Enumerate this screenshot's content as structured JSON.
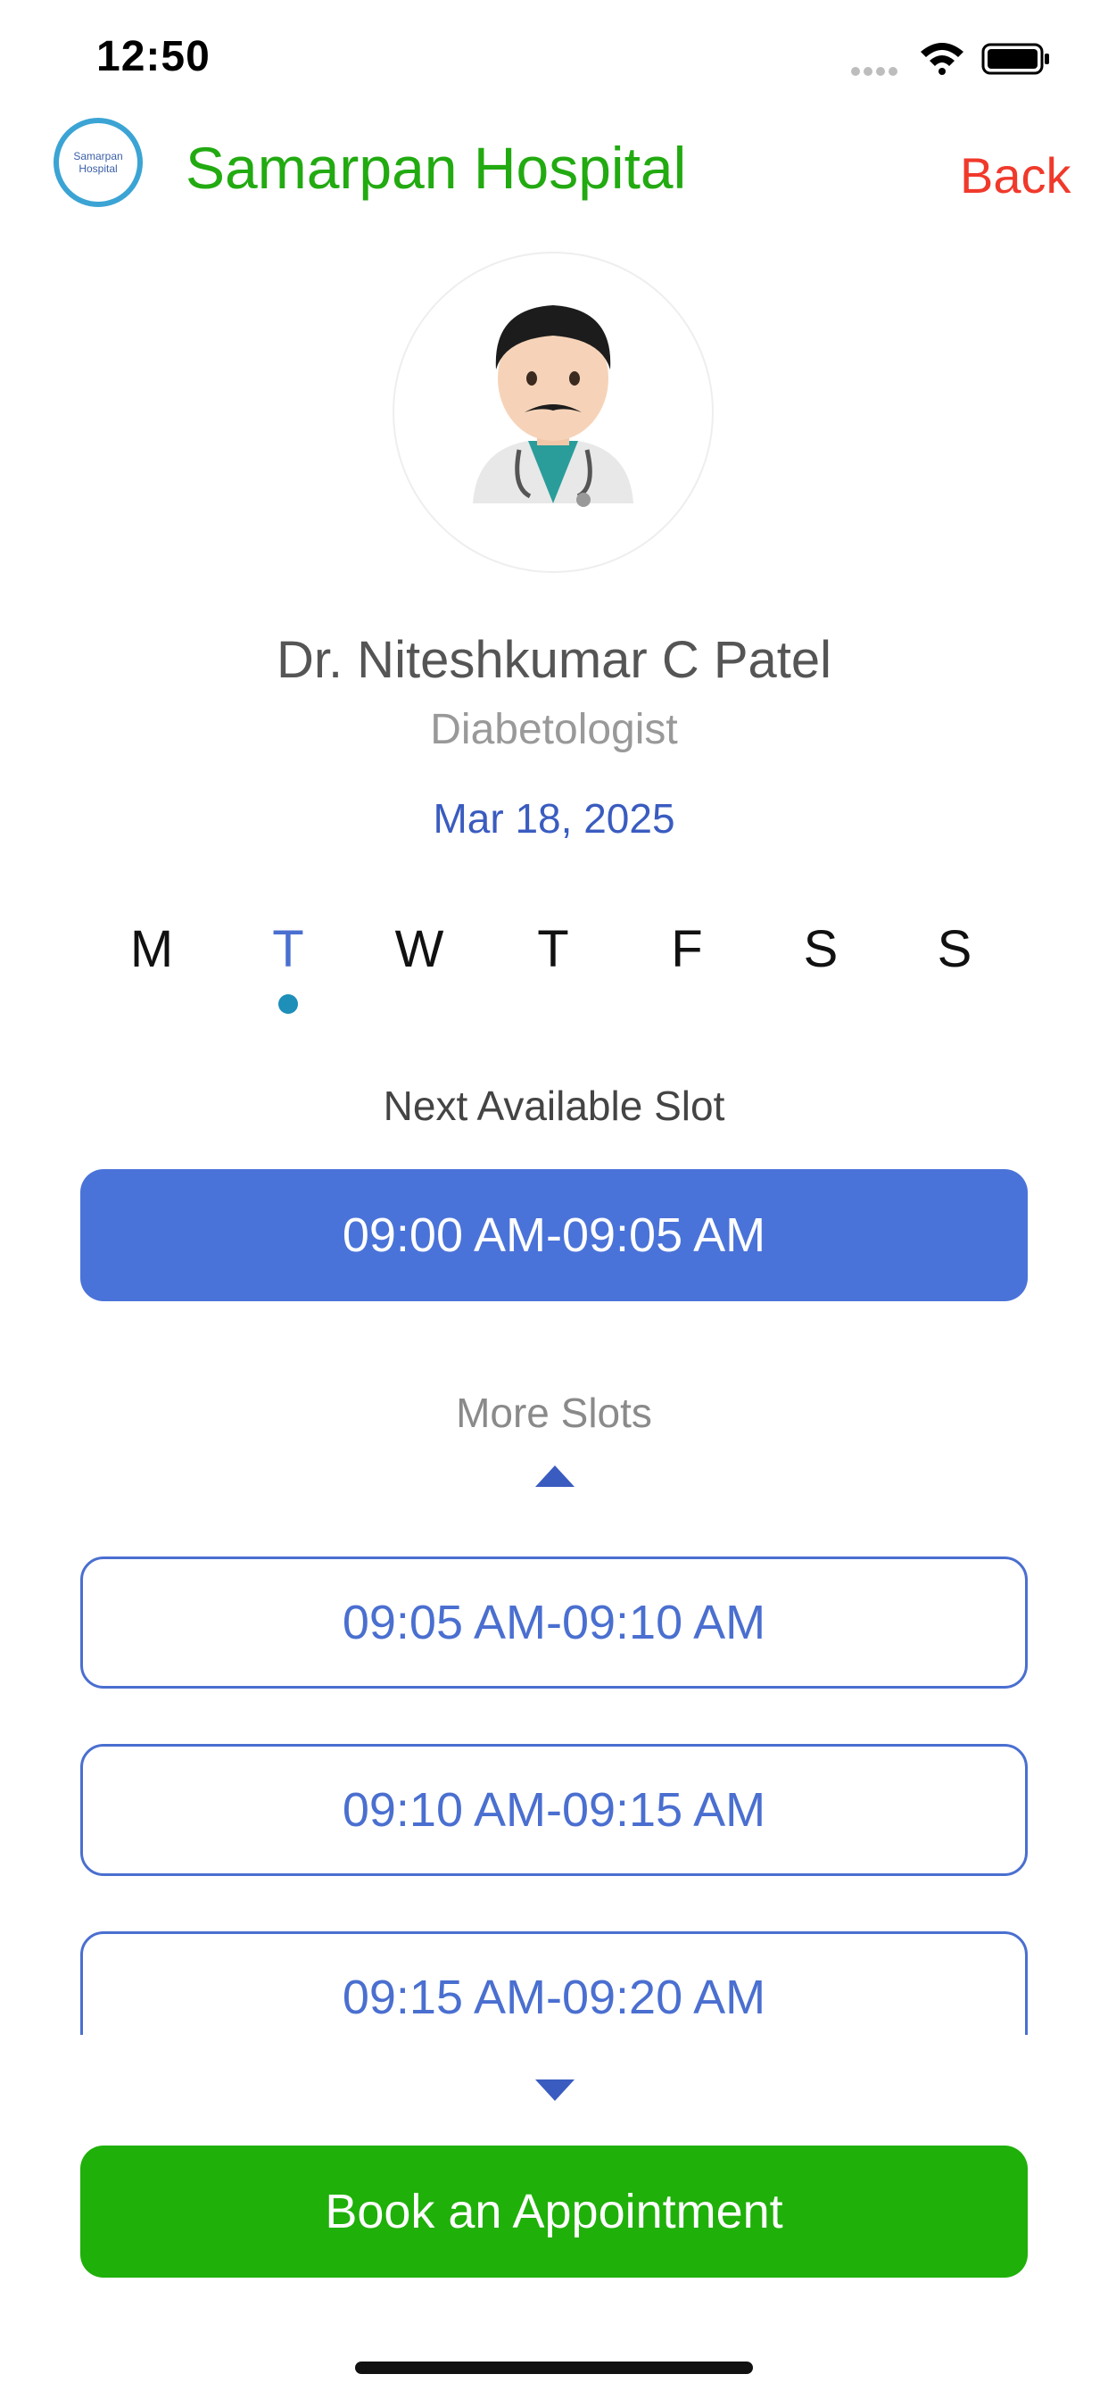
{
  "status_bar": {
    "time": "12:50"
  },
  "header": {
    "logo_text_1": "Samarpan",
    "logo_text_2": "Hospital",
    "title": "Samarpan Hospital",
    "back_label": "Back"
  },
  "doctor": {
    "avatar_emoji": "👨🏻‍⚕️",
    "name": "Dr. Niteshkumar C Patel",
    "specialty": "Diabetologist",
    "date": "Mar 18, 2025"
  },
  "week": {
    "days": [
      "M",
      "T",
      "W",
      "T",
      "F",
      "S",
      "S"
    ],
    "selected_index": 1
  },
  "slots": {
    "next_label": "Next Available Slot",
    "next_slot": "09:00 AM-09:05 AM",
    "more_label": "More Slots",
    "items": [
      "09:05 AM-09:10 AM",
      "09:10 AM-09:15 AM",
      "09:15 AM-09:20 AM"
    ]
  },
  "book_label": "Book an Appointment",
  "colors": {
    "brand_green": "#22aa11",
    "back_red": "#f0392b",
    "slot_blue": "#4a73d9",
    "book_green": "#1fb009"
  }
}
